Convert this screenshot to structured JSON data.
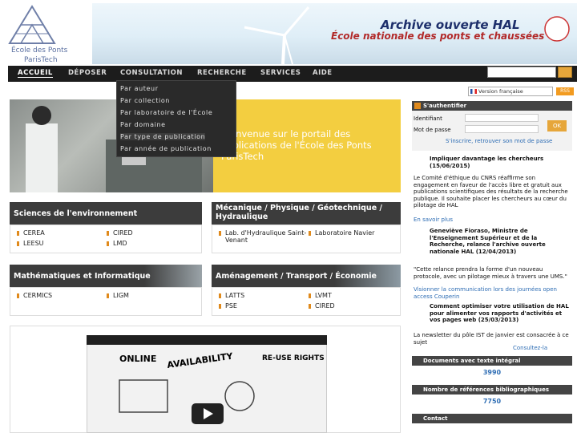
{
  "header": {
    "logo_line1": "École des Ponts",
    "logo_line2": "ParisTech",
    "hal_title": "Archive ouverte HAL",
    "hal_subtitle": "École nationale des ponts et chaussées"
  },
  "nav": {
    "items": [
      "ACCUEIL",
      "DÉPOSER",
      "CONSULTATION",
      "RECHERCHE",
      "SERVICES",
      "AIDE"
    ]
  },
  "dropdown": {
    "items": [
      "Par auteur",
      "Par collection",
      "Par laboratoire de l'École",
      "Par domaine",
      "Par type de publication",
      "Par année de publication"
    ]
  },
  "lang": {
    "selected": "Version française"
  },
  "rss_label": "RSS",
  "hero": {
    "text": "Bienvenue sur le portail des publications de l'École des Ponts ParisTech"
  },
  "tiles": [
    {
      "title": "Sciences de l'environnement",
      "links": [
        "CEREA",
        "CIRED",
        "LEESU",
        "LMD"
      ]
    },
    {
      "title": "Mécanique / Physique / Géotechnique / Hydraulique",
      "links": [
        "Lab. d'Hydraulique Saint-Venant",
        "Laboratoire Navier"
      ]
    },
    {
      "title": "Mathématiques et Informatique",
      "links": [
        "CERMICS",
        "LIGM"
      ]
    },
    {
      "title": "Aménagement / Transport / Économie",
      "links": [
        "LATTS",
        "LVMT",
        "PSE",
        "CIRED"
      ]
    }
  ],
  "video": {
    "word1": "ONLINE",
    "word2": "AVAILABILITY",
    "word3": "RE-USE RIGHTS"
  },
  "sidebar": {
    "auth_title": "S'authentifier",
    "login_label": "Identifiant",
    "password_label": "Mot de passe",
    "ok_label": "OK",
    "auth_links": "S'inscrire, retrouver son mot de passe",
    "news1_title": "Impliquer davantage les chercheurs (15/06/2015)",
    "news1_text": "Le Comité d'éthique du CNRS réaffirme son engagement en faveur de l'accès libre et gratuit aux publications scientifiques des résultats de la recherche publique. Il souhaite placer les chercheurs au cœur du pilotage de HAL",
    "news1_more": "En savoir plus",
    "news2_title": "Geneviève Fioraso, Ministre de l'Enseignement Supérieur et de la Recherche, relance l'archive ouverte nationale HAL (12/04/2013)",
    "news2_text": "\"Cette relance prendra la forme d'un nouveau protocole, avec un pilotage mieux à travers une UMS.\"",
    "news2_more": "Visionner la communication lors des journées open access Couperin",
    "news3_title": "Comment optimiser votre utilisation de HAL pour alimenter vos rapports d'activités et vos pages web (25/03/2013)",
    "news3_text": "La newsletter du pôle IST de janvier est consacrée à ce sujet",
    "news3_more": "Consultez-la",
    "stat1_label": "Documents avec texte intégral",
    "stat1_value": "3990",
    "stat2_label": "Nombre de références bibliographiques",
    "stat2_value": "7750",
    "contact_label": "Contact"
  }
}
